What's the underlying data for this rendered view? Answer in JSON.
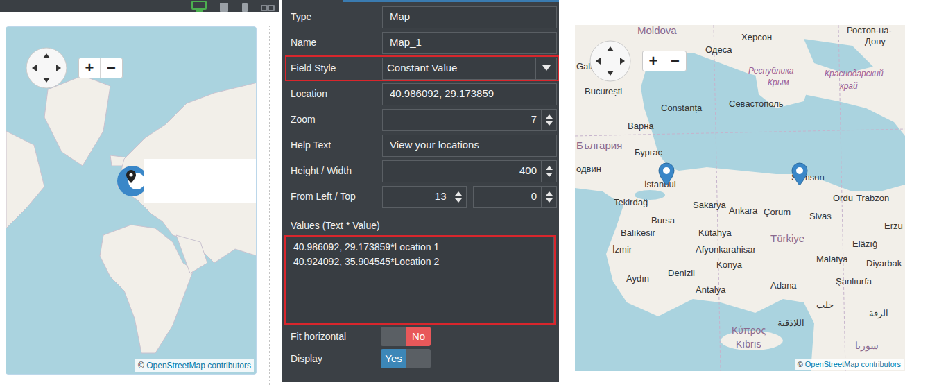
{
  "toolbar": {
    "devices": [
      {
        "kind": "monitor",
        "selected": true
      },
      {
        "kind": "tablet",
        "selected": false
      },
      {
        "kind": "phone",
        "selected": false
      },
      {
        "kind": "split",
        "selected": false
      }
    ]
  },
  "left_map": {
    "zoom_in": "+",
    "zoom_out": "−",
    "attribution_symbol": "©",
    "attribution_link": "OpenStreetMap",
    "attribution_text": "contributors"
  },
  "properties": {
    "rows": [
      {
        "label": "Type",
        "kind": "text",
        "value": "Map",
        "highlighted": false
      },
      {
        "label": "Name",
        "kind": "text",
        "value": "Map_1",
        "highlighted": false
      },
      {
        "label": "Field Style",
        "kind": "select",
        "value": "Constant Value",
        "highlighted": true
      },
      {
        "label": "Location",
        "kind": "text",
        "value": "40.986092, 29.173859",
        "highlighted": false
      },
      {
        "label": "Zoom",
        "kind": "number",
        "value": "7",
        "highlighted": false
      },
      {
        "label": "Help Text",
        "kind": "text",
        "value": "View your locations",
        "highlighted": false
      },
      {
        "label": "Height / Width",
        "kind": "number",
        "value": "400",
        "highlighted": false
      },
      {
        "label": "From Left / Top",
        "kind": "pair",
        "values": [
          "13",
          "0"
        ],
        "highlighted": false
      }
    ],
    "values_label": "Values (Text * Value)",
    "values": [
      "40.986092, 29.173859*Location 1",
      "40.924092, 35.904545*Location 2"
    ],
    "values_highlighted": true,
    "toggles": [
      {
        "label": "Fit horizontal",
        "text": "No",
        "on": false
      },
      {
        "label": "Display",
        "text": "Yes",
        "on": true
      }
    ]
  },
  "right_map": {
    "zoom_in": "+",
    "zoom_out": "−",
    "attribution_symbol": "©",
    "attribution_link": "OpenStreetMap",
    "attribution_text": "contributors",
    "labels": [
      {
        "text": "Moldova",
        "kind": "country"
      },
      {
        "text": "Херсон",
        "kind": "city"
      },
      {
        "text": "Ростов-на-",
        "kind": "city"
      },
      {
        "text": "Дону",
        "kind": "city"
      },
      {
        "text": "Одеса",
        "kind": "city"
      },
      {
        "text": "Galați",
        "kind": "city"
      },
      {
        "text": "București",
        "kind": "city"
      },
      {
        "text": "Республика",
        "kind": "region"
      },
      {
        "text": "Крым",
        "kind": "region"
      },
      {
        "text": "Краснодарский",
        "kind": "region"
      },
      {
        "text": "край",
        "kind": "region"
      },
      {
        "text": "Constanța",
        "kind": "city"
      },
      {
        "text": "Севастополь",
        "kind": "city"
      },
      {
        "text": "Варна",
        "kind": "city"
      },
      {
        "text": "България",
        "kind": "country"
      },
      {
        "text": "Бургас",
        "kind": "city"
      },
      {
        "text": "одвин",
        "kind": "city"
      },
      {
        "text": "İstanbul",
        "kind": "city"
      },
      {
        "text": "Samsun",
        "kind": "city"
      },
      {
        "text": "Tekirdağ",
        "kind": "city"
      },
      {
        "text": "Sakarya",
        "kind": "city"
      },
      {
        "text": "Ankara",
        "kind": "city"
      },
      {
        "text": "Çorum",
        "kind": "city"
      },
      {
        "text": "Ordu",
        "kind": "city"
      },
      {
        "text": "Trabzon",
        "kind": "city"
      },
      {
        "text": "Bursa",
        "kind": "city"
      },
      {
        "text": "Sivas",
        "kind": "city"
      },
      {
        "text": "Erzu",
        "kind": "city"
      },
      {
        "text": "Balıkesir",
        "kind": "city"
      },
      {
        "text": "Kütahya",
        "kind": "city"
      },
      {
        "text": "Türkiye",
        "kind": "country"
      },
      {
        "text": "Elâzığ",
        "kind": "city"
      },
      {
        "text": "İzmir",
        "kind": "city"
      },
      {
        "text": "Afyonkarahisar",
        "kind": "city"
      },
      {
        "text": "Malatya",
        "kind": "city"
      },
      {
        "text": "Diyarbak",
        "kind": "city"
      },
      {
        "text": "Konya",
        "kind": "city"
      },
      {
        "text": "Aydın",
        "kind": "city"
      },
      {
        "text": "Denizli",
        "kind": "city"
      },
      {
        "text": "Antalya",
        "kind": "city"
      },
      {
        "text": "Adana",
        "kind": "city"
      },
      {
        "text": "Şanlıurfa",
        "kind": "city"
      },
      {
        "text": "حلب",
        "kind": "city"
      },
      {
        "text": "الرقة",
        "kind": "city"
      },
      {
        "text": "اللاذقية",
        "kind": "city"
      },
      {
        "text": "Κύπρος",
        "kind": "country"
      },
      {
        "text": "Kıbrıs",
        "kind": "country"
      },
      {
        "text": "سوريا",
        "kind": "country"
      }
    ]
  }
}
